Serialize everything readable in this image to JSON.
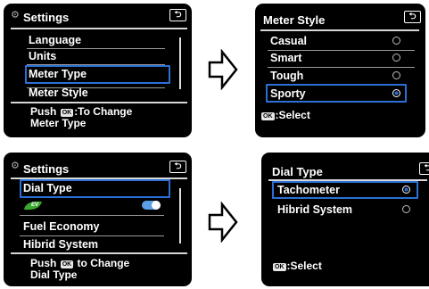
{
  "panel_settings_units": {
    "title": "Settings",
    "items": [
      "Language",
      "Units",
      "Meter Type",
      "Meter Style"
    ],
    "selected": "Meter Type",
    "footer_line1_prefix": "Push",
    "footer_ok": "OK",
    "footer_line1_suffix": ":To Change",
    "footer_line2": "Meter Type"
  },
  "panel_meter_style": {
    "title": "Meter Style",
    "options": [
      "Casual",
      "Smart",
      "Tough",
      "Sporty"
    ],
    "selected": "Sporty",
    "footer_ok": "OK",
    "footer_text": ":Select"
  },
  "panel_settings_dial": {
    "title": "Settings",
    "items": [
      "Dial Type",
      "EV",
      "Fuel Economy",
      "Hibrid System"
    ],
    "selected": "Dial Type",
    "ev_toggle_on": true,
    "footer_line1_prefix": "Push",
    "footer_ok": "OK",
    "footer_line1_suffix": "to Change",
    "footer_line2": "Dial Type"
  },
  "panel_dial_type": {
    "title": "Dial Type",
    "options": [
      "Tachometer",
      "Hibrid System"
    ],
    "selected": "Tachometer",
    "footer_ok": "OK",
    "footer_text": ":Select"
  },
  "colors": {
    "highlight": "#2c6fd6",
    "eco_green": "#3aa82e",
    "toggle_blue": "#5aa0e6"
  },
  "icons": {
    "gear": "gear-icon",
    "back": "back-icon",
    "arrow": "right-arrow-icon",
    "eco": "ev-eco-icon"
  }
}
